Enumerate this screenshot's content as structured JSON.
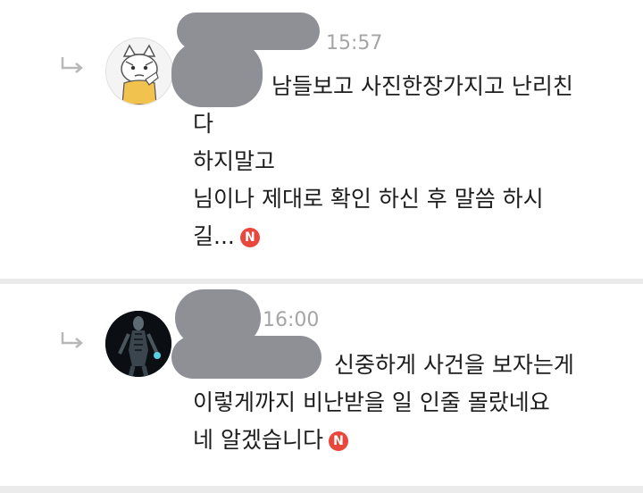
{
  "comments": [
    {
      "time": "15:57",
      "lines": [
        "남들보고 사진한장가지고 난리친",
        "다",
        "하지말고",
        "님이나 제대로 확인 하신 후 말씀 하시",
        "길..."
      ],
      "avatar_icon": "cartoon-cat-avatar-icon",
      "badge": "N"
    },
    {
      "time": "16:00",
      "lines": [
        "신중하게 사건을 보자는게",
        "이렇게까지 비난받을 일 인줄 몰랐네요",
        "네 알겠습니다"
      ],
      "avatar_icon": "dark-figure-avatar-icon",
      "badge": "N"
    }
  ],
  "colors": {
    "badge": "#e8483b",
    "timestamp": "#a5a5a5",
    "blur": "#8e9096",
    "divider": "#ebebeb"
  }
}
